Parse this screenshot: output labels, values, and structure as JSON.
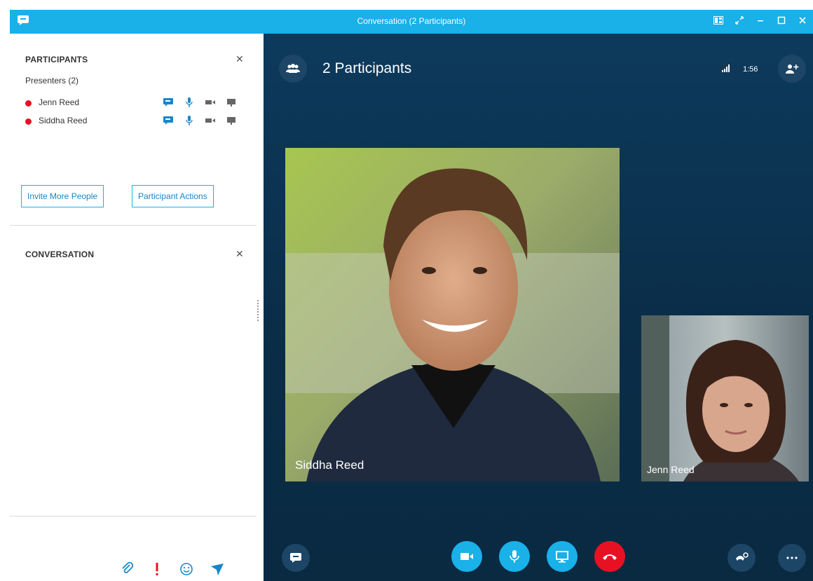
{
  "window": {
    "title": "Conversation (2 Participants)"
  },
  "participants_panel": {
    "title": "PARTICIPANTS",
    "presenters_label": "Presenters (2)",
    "people": [
      {
        "name": "Jenn Reed",
        "status_color": "#e81123"
      },
      {
        "name": "Siddha Reed",
        "status_color": "#e81123"
      }
    ],
    "invite_button": "Invite More People",
    "actions_button": "Participant Actions"
  },
  "conversation_panel": {
    "title": "CONVERSATION"
  },
  "stage": {
    "participant_count_label": "2 Participants",
    "call_duration": "1:56",
    "main_video_name": "Siddha Reed",
    "self_video_name": "Jenn Reed"
  },
  "colors": {
    "accent": "#1ab0e8",
    "hangup": "#e81123",
    "stage_bg": "#0d3a5c"
  }
}
